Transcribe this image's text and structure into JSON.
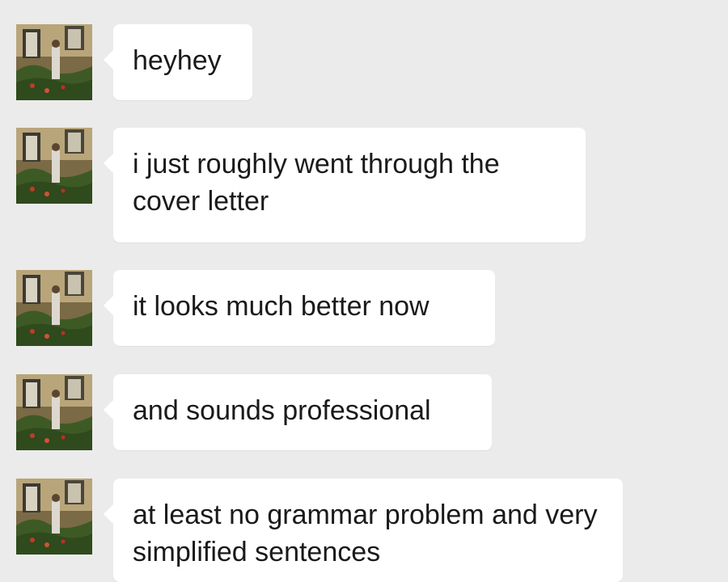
{
  "chat": {
    "messages": [
      {
        "text": "heyhey",
        "avatar_icon": "user-avatar-icon"
      },
      {
        "text": "i just roughly went through the cover letter",
        "avatar_icon": "user-avatar-icon"
      },
      {
        "text": "it looks much better now",
        "avatar_icon": "user-avatar-icon"
      },
      {
        "text": "and sounds professional",
        "avatar_icon": "user-avatar-icon"
      },
      {
        "text": "at least no grammar problem and very simplified sentences",
        "avatar_icon": "user-avatar-icon"
      }
    ]
  },
  "colors": {
    "background": "#ebebeb",
    "bubble": "#ffffff",
    "text": "#1a1a1a"
  }
}
